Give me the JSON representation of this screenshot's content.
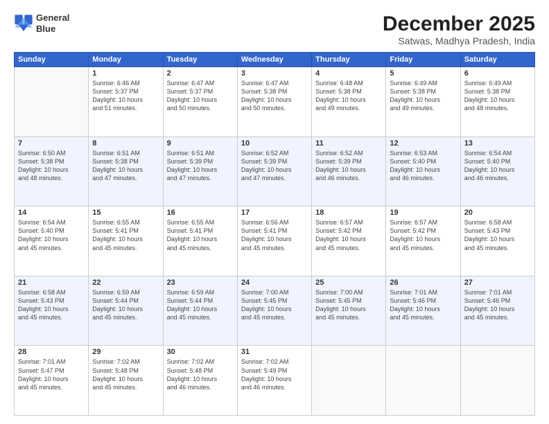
{
  "logo": {
    "line1": "General",
    "line2": "Blue"
  },
  "title": "December 2025",
  "subtitle": "Satwas, Madhya Pradesh, India",
  "headers": [
    "Sunday",
    "Monday",
    "Tuesday",
    "Wednesday",
    "Thursday",
    "Friday",
    "Saturday"
  ],
  "weeks": [
    [
      {
        "day": "",
        "info": ""
      },
      {
        "day": "1",
        "info": "Sunrise: 6:46 AM\nSunset: 5:37 PM\nDaylight: 10 hours\nand 51 minutes."
      },
      {
        "day": "2",
        "info": "Sunrise: 6:47 AM\nSunset: 5:37 PM\nDaylight: 10 hours\nand 50 minutes."
      },
      {
        "day": "3",
        "info": "Sunrise: 6:47 AM\nSunset: 5:38 PM\nDaylight: 10 hours\nand 50 minutes."
      },
      {
        "day": "4",
        "info": "Sunrise: 6:48 AM\nSunset: 5:38 PM\nDaylight: 10 hours\nand 49 minutes."
      },
      {
        "day": "5",
        "info": "Sunrise: 6:49 AM\nSunset: 5:38 PM\nDaylight: 10 hours\nand 49 minutes."
      },
      {
        "day": "6",
        "info": "Sunrise: 6:49 AM\nSunset: 5:38 PM\nDaylight: 10 hours\nand 48 minutes."
      }
    ],
    [
      {
        "day": "7",
        "info": "Sunrise: 6:50 AM\nSunset: 5:38 PM\nDaylight: 10 hours\nand 48 minutes."
      },
      {
        "day": "8",
        "info": "Sunrise: 6:51 AM\nSunset: 5:38 PM\nDaylight: 10 hours\nand 47 minutes."
      },
      {
        "day": "9",
        "info": "Sunrise: 6:51 AM\nSunset: 5:39 PM\nDaylight: 10 hours\nand 47 minutes."
      },
      {
        "day": "10",
        "info": "Sunrise: 6:52 AM\nSunset: 5:39 PM\nDaylight: 10 hours\nand 47 minutes."
      },
      {
        "day": "11",
        "info": "Sunrise: 6:52 AM\nSunset: 5:39 PM\nDaylight: 10 hours\nand 46 minutes."
      },
      {
        "day": "12",
        "info": "Sunrise: 6:53 AM\nSunset: 5:40 PM\nDaylight: 10 hours\nand 46 minutes."
      },
      {
        "day": "13",
        "info": "Sunrise: 6:54 AM\nSunset: 5:40 PM\nDaylight: 10 hours\nand 46 minutes."
      }
    ],
    [
      {
        "day": "14",
        "info": "Sunrise: 6:54 AM\nSunset: 5:40 PM\nDaylight: 10 hours\nand 45 minutes."
      },
      {
        "day": "15",
        "info": "Sunrise: 6:55 AM\nSunset: 5:41 PM\nDaylight: 10 hours\nand 45 minutes."
      },
      {
        "day": "16",
        "info": "Sunrise: 6:55 AM\nSunset: 5:41 PM\nDaylight: 10 hours\nand 45 minutes."
      },
      {
        "day": "17",
        "info": "Sunrise: 6:56 AM\nSunset: 5:41 PM\nDaylight: 10 hours\nand 45 minutes."
      },
      {
        "day": "18",
        "info": "Sunrise: 6:57 AM\nSunset: 5:42 PM\nDaylight: 10 hours\nand 45 minutes."
      },
      {
        "day": "19",
        "info": "Sunrise: 6:57 AM\nSunset: 5:42 PM\nDaylight: 10 hours\nand 45 minutes."
      },
      {
        "day": "20",
        "info": "Sunrise: 6:58 AM\nSunset: 5:43 PM\nDaylight: 10 hours\nand 45 minutes."
      }
    ],
    [
      {
        "day": "21",
        "info": "Sunrise: 6:58 AM\nSunset: 5:43 PM\nDaylight: 10 hours\nand 45 minutes."
      },
      {
        "day": "22",
        "info": "Sunrise: 6:59 AM\nSunset: 5:44 PM\nDaylight: 10 hours\nand 45 minutes."
      },
      {
        "day": "23",
        "info": "Sunrise: 6:59 AM\nSunset: 5:44 PM\nDaylight: 10 hours\nand 45 minutes."
      },
      {
        "day": "24",
        "info": "Sunrise: 7:00 AM\nSunset: 5:45 PM\nDaylight: 10 hours\nand 45 minutes."
      },
      {
        "day": "25",
        "info": "Sunrise: 7:00 AM\nSunset: 5:45 PM\nDaylight: 10 hours\nand 45 minutes."
      },
      {
        "day": "26",
        "info": "Sunrise: 7:01 AM\nSunset: 5:46 PM\nDaylight: 10 hours\nand 45 minutes."
      },
      {
        "day": "27",
        "info": "Sunrise: 7:01 AM\nSunset: 5:46 PM\nDaylight: 10 hours\nand 45 minutes."
      }
    ],
    [
      {
        "day": "28",
        "info": "Sunrise: 7:01 AM\nSunset: 5:47 PM\nDaylight: 10 hours\nand 45 minutes."
      },
      {
        "day": "29",
        "info": "Sunrise: 7:02 AM\nSunset: 5:48 PM\nDaylight: 10 hours\nand 45 minutes."
      },
      {
        "day": "30",
        "info": "Sunrise: 7:02 AM\nSunset: 5:48 PM\nDaylight: 10 hours\nand 46 minutes."
      },
      {
        "day": "31",
        "info": "Sunrise: 7:02 AM\nSunset: 5:49 PM\nDaylight: 10 hours\nand 46 minutes."
      },
      {
        "day": "",
        "info": ""
      },
      {
        "day": "",
        "info": ""
      },
      {
        "day": "",
        "info": ""
      }
    ]
  ]
}
